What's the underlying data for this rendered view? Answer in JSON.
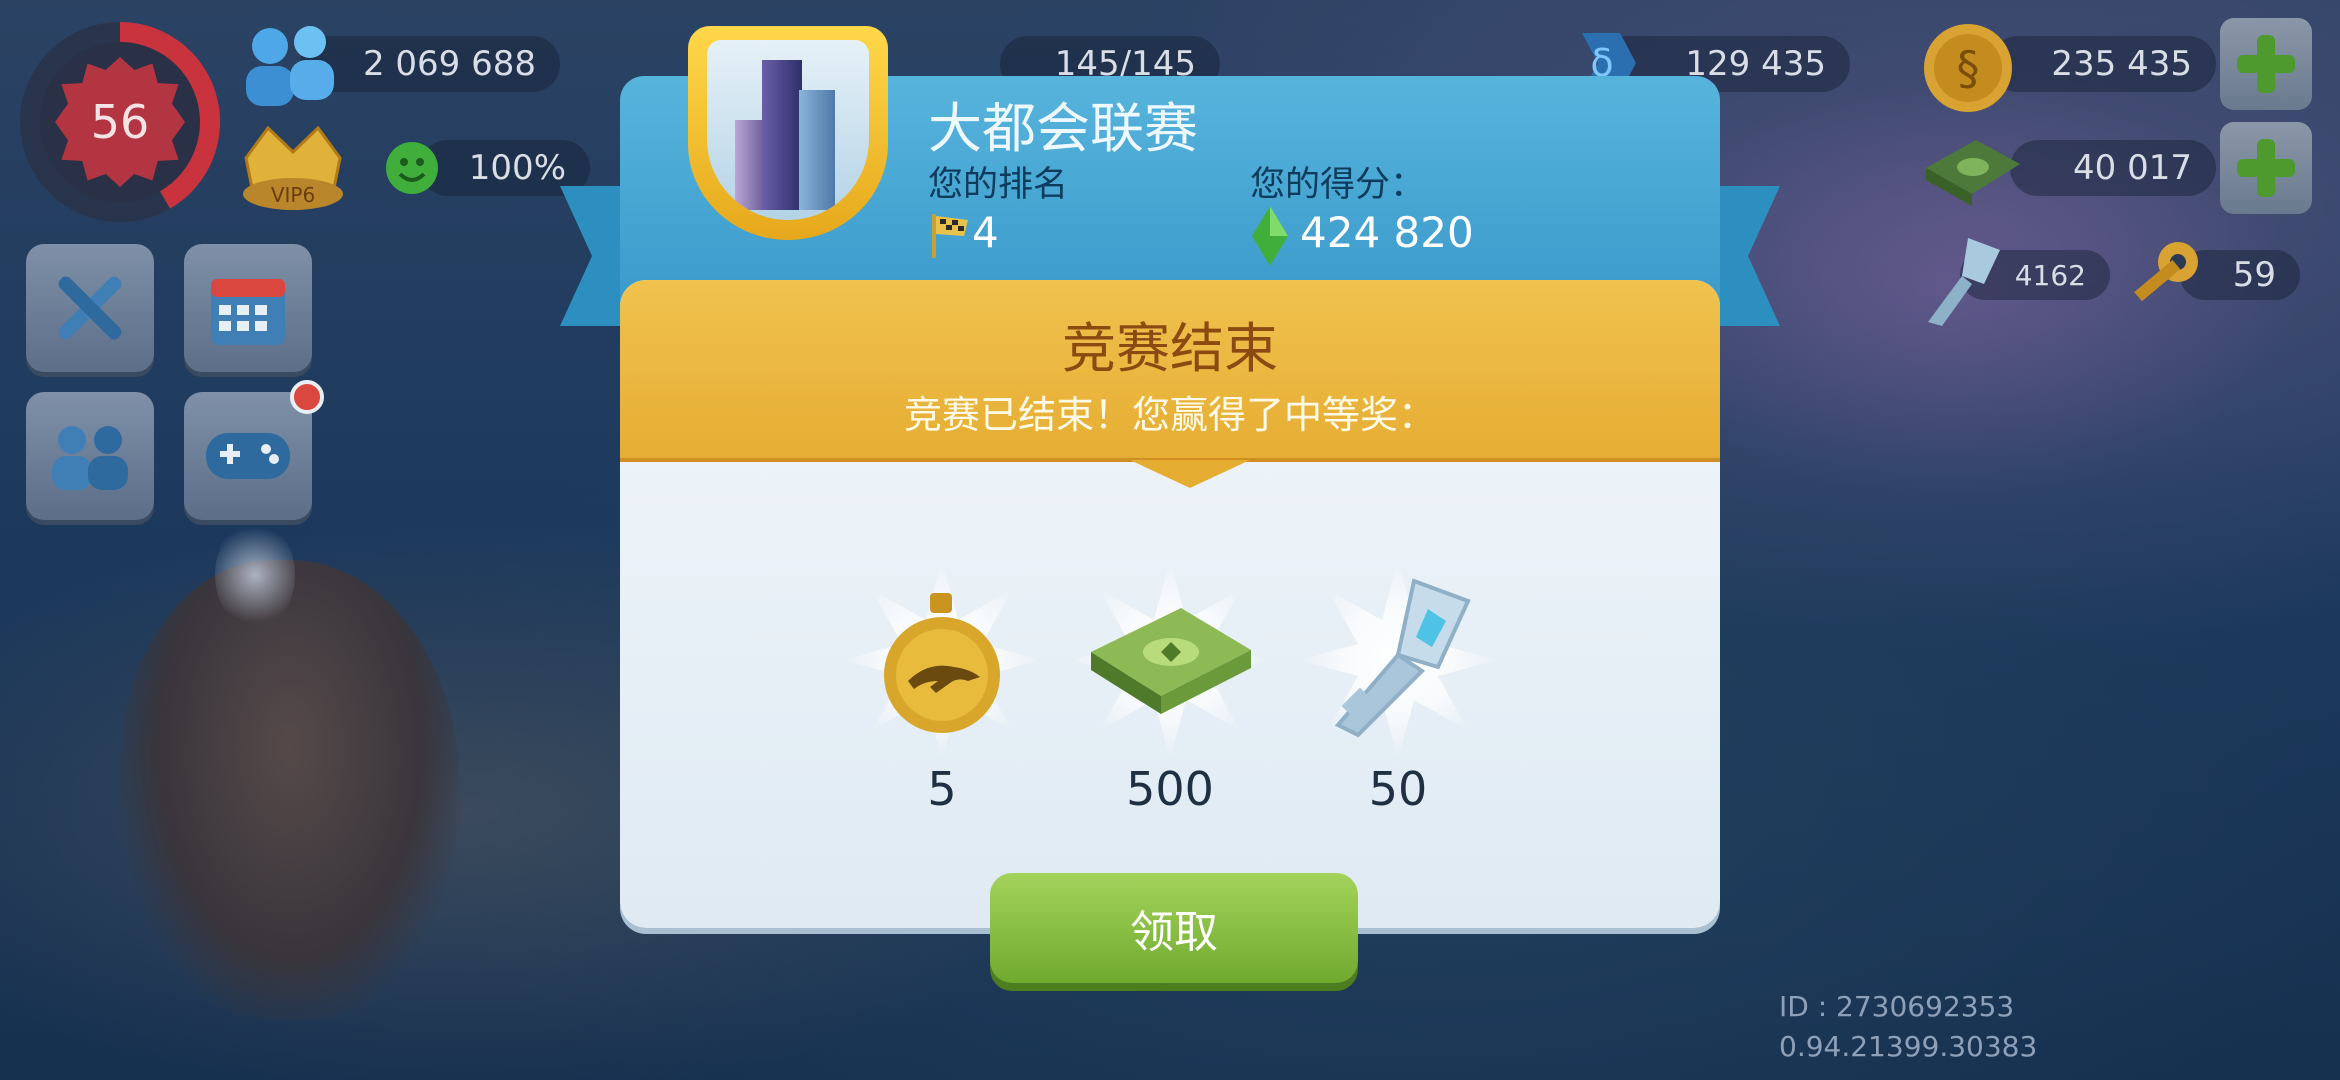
{
  "hud": {
    "level": "56",
    "population": "2 069 688",
    "vip": "VIP6",
    "happiness": "100%",
    "capacity": "145/145",
    "neo_simoleons": "129 435",
    "simcash": "235 435",
    "simoleons": "40 017",
    "war_keys": "4162",
    "golden_keys": "59"
  },
  "dialog": {
    "title": "大都会联赛",
    "rank_label": "您的排名",
    "rank_value": "4",
    "score_label": "您的得分：",
    "score_value": "424 820",
    "banner_title": "竞赛结束",
    "banner_subtitle": "竞赛已结束！您赢得了中等奖：",
    "rewards": [
      {
        "icon": "golden-cheetah-coin-icon",
        "count": "5"
      },
      {
        "icon": "simoleon-cash-stack-icon",
        "count": "500"
      },
      {
        "icon": "platinum-key-icon",
        "count": "50"
      }
    ],
    "claim_label": "领取"
  },
  "footer": {
    "id_line": "ID : 2730692353",
    "version": "0.94.21399.30383"
  },
  "colors": {
    "header_blue": "#3b99cb",
    "banner_gold": "#e6ad33",
    "claim_green": "#6faa2e"
  }
}
